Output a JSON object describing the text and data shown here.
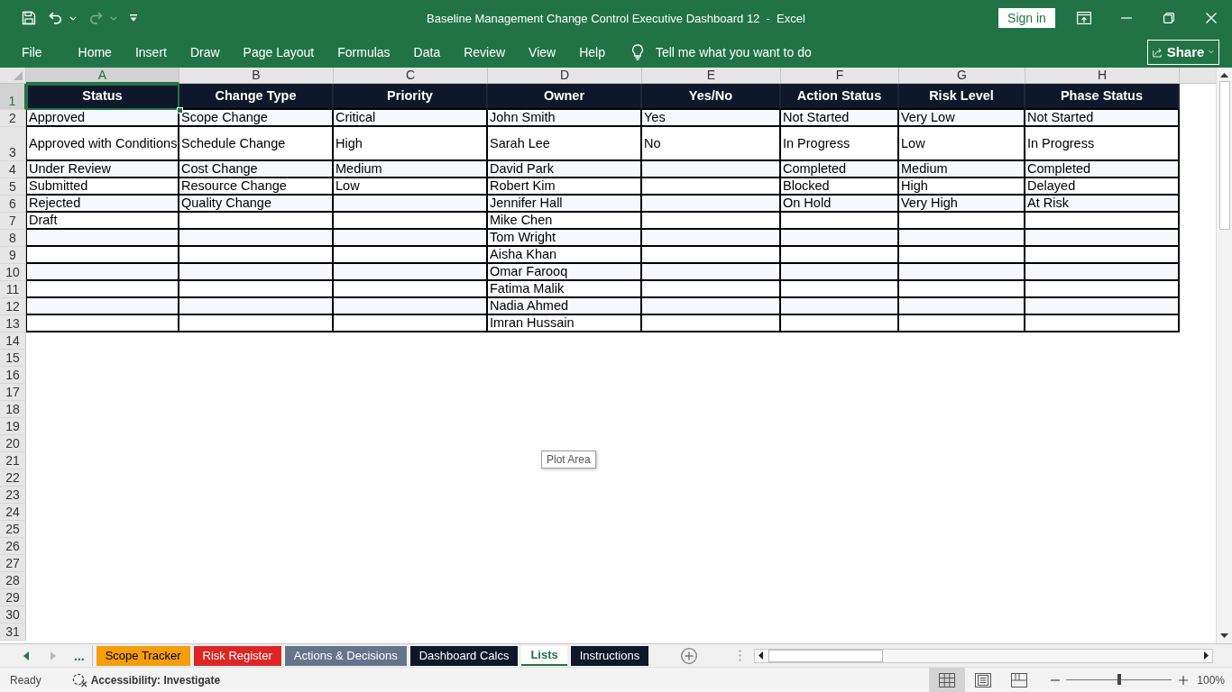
{
  "window": {
    "title": "Baseline Management Change Control Executive Dashboard 12  -  Excel",
    "sign_in": "Sign in"
  },
  "quick_access": [
    {
      "kind": "save",
      "disabled": false
    },
    {
      "kind": "undo",
      "disabled": false
    },
    {
      "kind": "redo",
      "disabled": true
    },
    {
      "kind": "customize",
      "disabled": false
    }
  ],
  "ribbon": {
    "tabs": [
      "File",
      "Home",
      "Insert",
      "Draw",
      "Page Layout",
      "Formulas",
      "Data",
      "Review",
      "View",
      "Help"
    ],
    "tell_me": {
      "placeholder": "Tell me what you want to do"
    },
    "share": "Share"
  },
  "sheet": {
    "column_headers": [
      {
        "label": "A",
        "selected": true
      },
      {
        "label": "B",
        "selected": false
      },
      {
        "label": "C",
        "selected": false
      },
      {
        "label": "D",
        "selected": false
      },
      {
        "label": "E",
        "selected": false
      },
      {
        "label": "F",
        "selected": false
      },
      {
        "label": "G",
        "selected": false
      },
      {
        "label": "H",
        "selected": false
      }
    ],
    "row_headers": [
      {
        "label": "1",
        "selected": true
      },
      {
        "label": "2",
        "selected": false
      },
      {
        "label": "3",
        "selected": false
      },
      {
        "label": "4",
        "selected": false
      },
      {
        "label": "5",
        "selected": false
      },
      {
        "label": "6",
        "selected": false
      },
      {
        "label": "7",
        "selected": false
      },
      {
        "label": "8",
        "selected": false
      },
      {
        "label": "9",
        "selected": false
      },
      {
        "label": "10",
        "selected": false
      },
      {
        "label": "11",
        "selected": false
      },
      {
        "label": "12",
        "selected": false
      },
      {
        "label": "13",
        "selected": false
      },
      {
        "label": "14",
        "selected": false
      },
      {
        "label": "15",
        "selected": false
      },
      {
        "label": "16",
        "selected": false
      },
      {
        "label": "17",
        "selected": false
      },
      {
        "label": "18",
        "selected": false
      },
      {
        "label": "19",
        "selected": false
      },
      {
        "label": "20",
        "selected": false
      },
      {
        "label": "21",
        "selected": false
      },
      {
        "label": "22",
        "selected": false
      },
      {
        "label": "23",
        "selected": false
      },
      {
        "label": "24",
        "selected": false
      },
      {
        "label": "25",
        "selected": false
      },
      {
        "label": "26",
        "selected": false
      },
      {
        "label": "27",
        "selected": false
      },
      {
        "label": "28",
        "selected": false
      },
      {
        "label": "29",
        "selected": false
      },
      {
        "label": "30",
        "selected": false
      },
      {
        "label": "31",
        "selected": false
      }
    ],
    "table": {
      "columns": [
        {
          "header": "Status",
          "values": [
            "Approved",
            "Approved with Conditions",
            "Under Review",
            "Submitted",
            "Rejected",
            "Draft"
          ]
        },
        {
          "header": "Change Type",
          "values": [
            "Scope Change",
            "Schedule Change",
            "Cost Change",
            "Resource Change",
            "Quality Change"
          ]
        },
        {
          "header": "Priority",
          "values": [
            "Critical",
            "High",
            "Medium",
            "Low"
          ]
        },
        {
          "header": "Owner",
          "values": [
            "John Smith",
            "Sarah Lee",
            "David Park",
            "Robert Kim",
            "Jennifer Hall",
            "Mike Chen",
            "Tom Wright",
            "Aisha Khan",
            "Omar Farooq",
            "Fatima Malik",
            "Nadia Ahmed",
            "Imran Hussain"
          ]
        },
        {
          "header": "Yes/No",
          "values": [
            "Yes",
            "No"
          ]
        },
        {
          "header": "Action Status",
          "values": [
            "Not Started",
            "In Progress",
            "Completed",
            "Blocked",
            "On Hold"
          ]
        },
        {
          "header": "Risk Level",
          "values": [
            "Very Low",
            "Low",
            "Medium",
            "High",
            "Very High"
          ]
        },
        {
          "header": "Phase Status",
          "values": [
            "Not Started",
            "In Progress",
            "Completed",
            "Delayed",
            "At Risk"
          ]
        }
      ]
    },
    "tooltip": "Plot Area"
  },
  "sheet_tabs": {
    "overflow": "...",
    "tabs": [
      {
        "label": "Scope Tracker",
        "selected": false,
        "color": "#f59e0b"
      },
      {
        "label": "Risk Register",
        "selected": false,
        "color": "#dc2626"
      },
      {
        "label": "Actions & Decisions",
        "selected": false,
        "color": "#64748b"
      },
      {
        "label": "Dashboard Calcs",
        "selected": false,
        "color": "#0f172a"
      },
      {
        "label": "Lists",
        "selected": true
      },
      {
        "label": "Instructions",
        "selected": false,
        "color": "#0f172a"
      }
    ]
  },
  "status_bar": {
    "status": "Ready",
    "accessibility": "Accessibility: Investigate",
    "views": [
      {
        "kind": "normal",
        "selected": true
      },
      {
        "kind": "page-layout",
        "selected": false
      },
      {
        "kind": "page-break",
        "selected": false
      }
    ],
    "zoom": {
      "level": 0.5,
      "reading": "100%"
    }
  }
}
